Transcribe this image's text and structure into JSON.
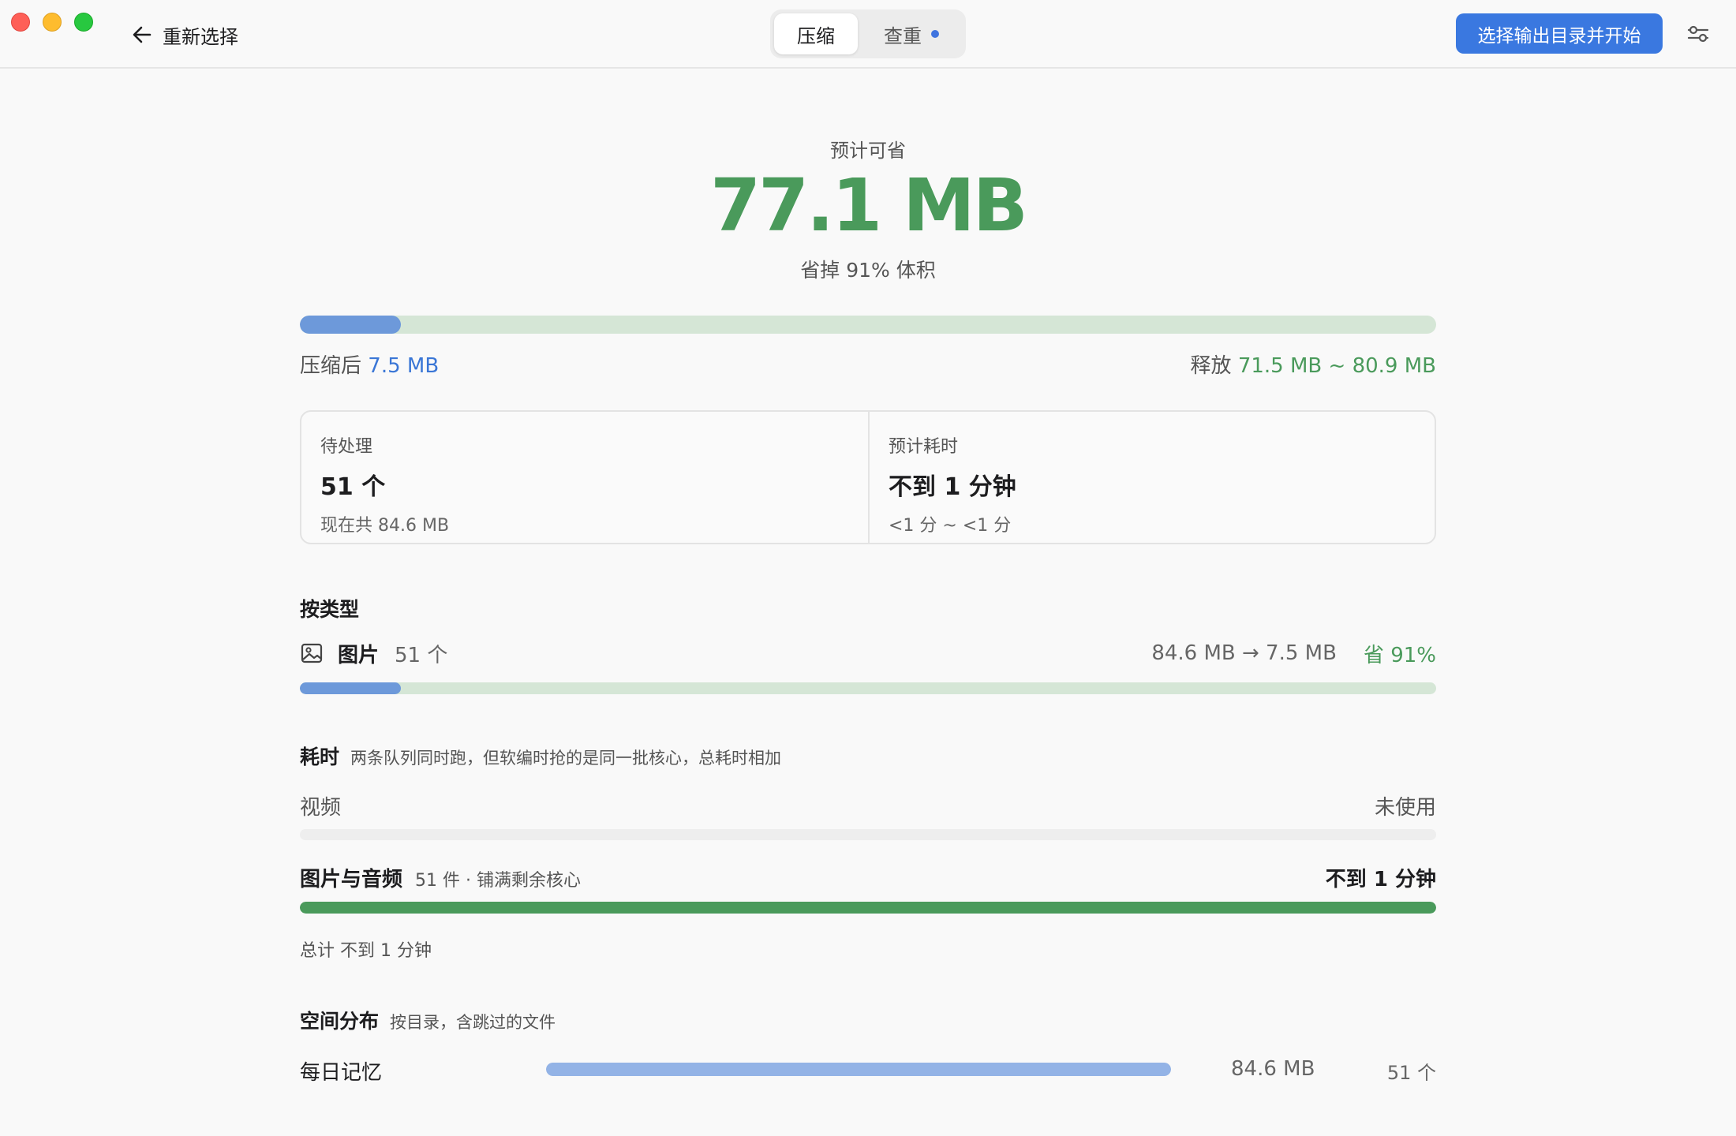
{
  "titlebar": {
    "back_label": "重新选择",
    "tabs": [
      {
        "label": "压缩",
        "active": true
      },
      {
        "label": "查重",
        "active": false,
        "has_dot": true
      }
    ],
    "primary_action": "选择输出目录并开始"
  },
  "summary": {
    "caption": "预计可省",
    "value": "77.1 MB",
    "subtitle": "省掉 91% 体积",
    "progress_fraction": 0.089,
    "after_label": "压缩后",
    "after_value": "7.5 MB",
    "release_label": "释放",
    "release_value": "71.5 MB ~ 80.9 MB"
  },
  "stats": [
    {
      "label": "待处理",
      "value": "51 个",
      "sub": "现在共 84.6 MB"
    },
    {
      "label": "预计耗时",
      "value": "不到 1 分钟",
      "sub": "<1 分 ~ <1 分"
    }
  ],
  "by_type": {
    "title": "按类型",
    "items": [
      {
        "icon": "image-icon",
        "name": "图片",
        "count": "51 个",
        "sizes": "84.6 MB → 7.5 MB",
        "save": "省 91%",
        "fraction": 0.089
      }
    ]
  },
  "time": {
    "title": "耗时",
    "note": "两条队列同时跑，但软编时抢的是同一批核心，总耗时相加",
    "lanes": [
      {
        "name": "视频",
        "meta": "",
        "right": "未使用",
        "fraction": 0
      },
      {
        "name": "图片与音频",
        "meta": "51 件 · 铺满剩余核心",
        "right": "不到 1 分钟",
        "fraction": 1
      }
    ],
    "total": "总计 不到 1 分钟"
  },
  "space": {
    "title": "空间分布",
    "note": "按目录，含跳过的文件",
    "rows": [
      {
        "label": "每日记忆",
        "size": "84.6 MB",
        "count": "51 个",
        "fraction": 1
      }
    ]
  },
  "colors": {
    "accent_blue": "#3a78e0",
    "saving_green": "#4a9a5b",
    "progress_blue": "#6d99da",
    "progress_track": "#d5e6d6"
  }
}
